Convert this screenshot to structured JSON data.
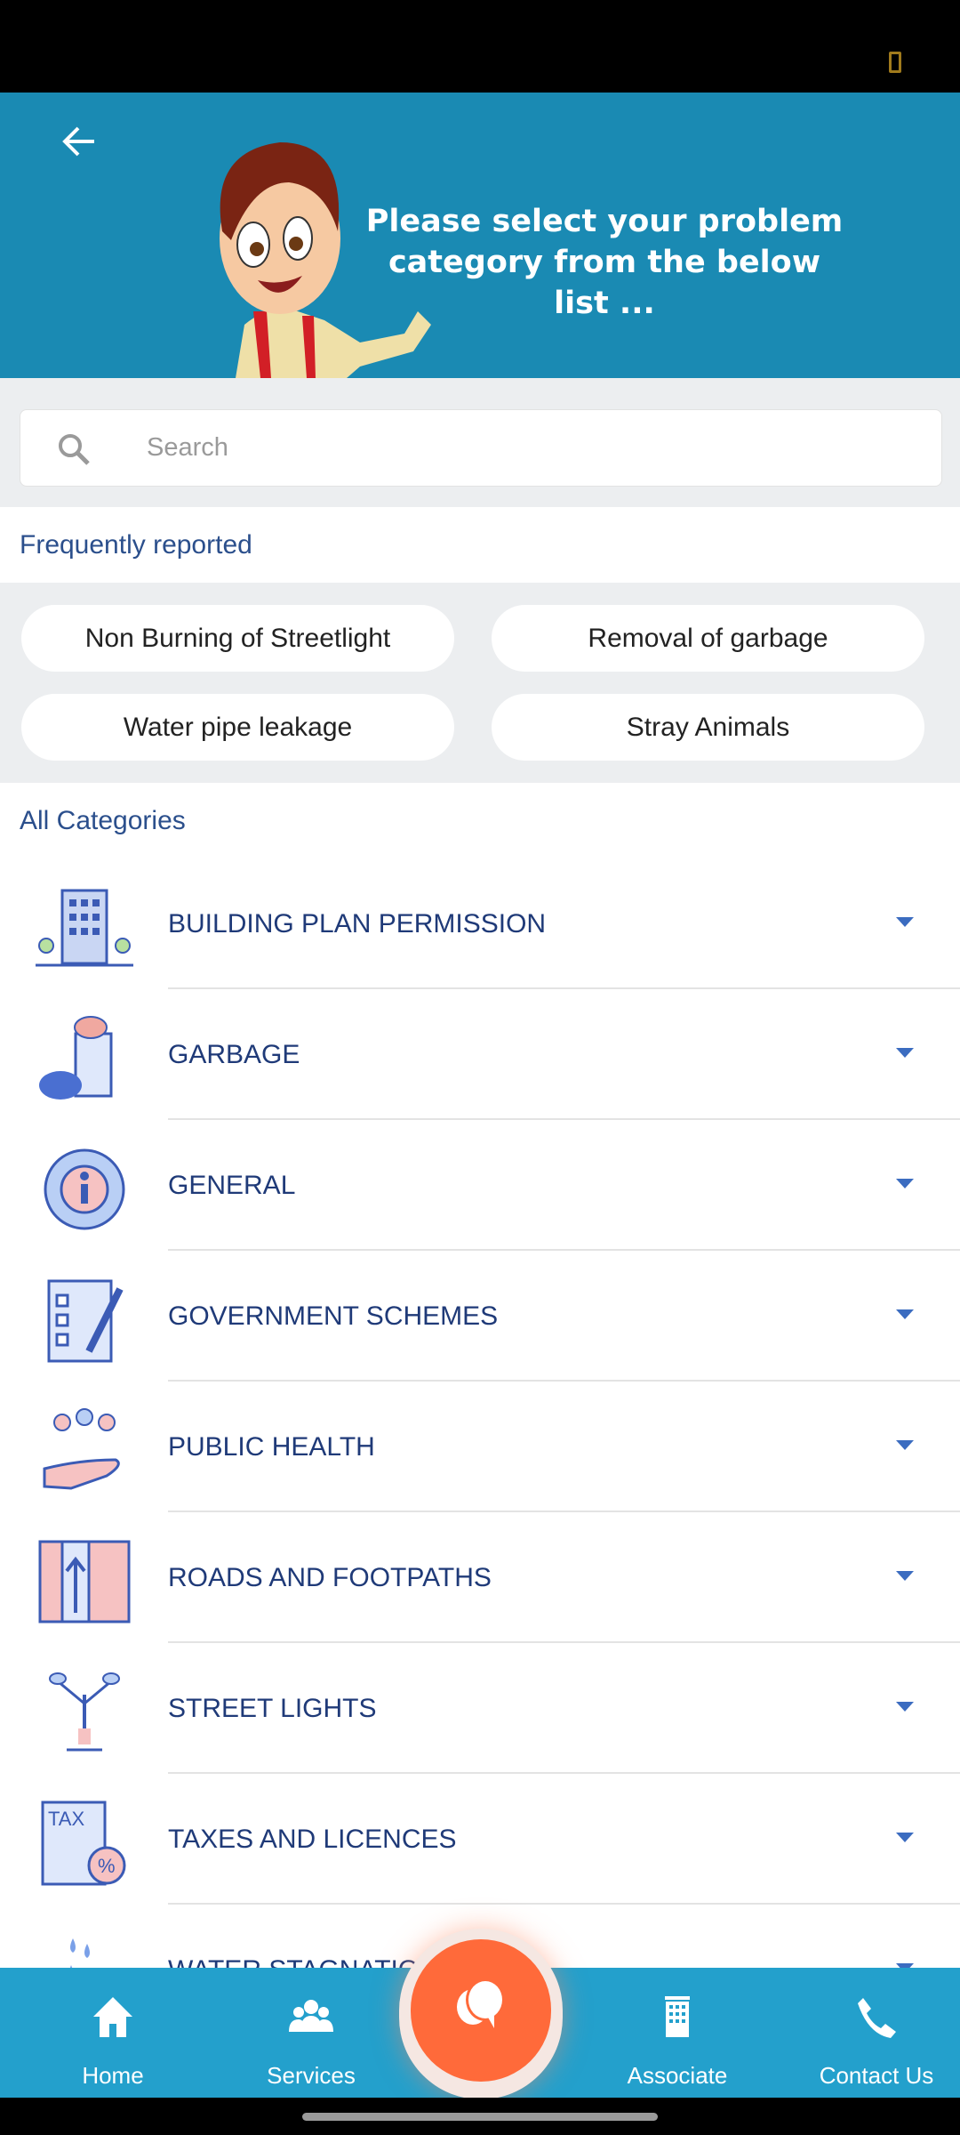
{
  "header": {
    "back_icon": "arrow-left-icon",
    "message": "Please select your problem category from the below list ...",
    "background": "#1a8ab3"
  },
  "search": {
    "placeholder": "Search",
    "value": ""
  },
  "frequent": {
    "title": "Frequently reported",
    "chips": [
      "Non Burning of Streetlight",
      "Removal of garbage",
      "Water pipe leakage",
      "Stray Animals"
    ]
  },
  "categories": {
    "title": "All Categories",
    "items": [
      {
        "label": "BUILDING PLAN PERMISSION",
        "icon": "building-icon"
      },
      {
        "label": "GARBAGE",
        "icon": "garbage-bin-icon"
      },
      {
        "label": "GENERAL",
        "icon": "info-icon"
      },
      {
        "label": "GOVERNMENT SCHEMES",
        "icon": "clipboard-checklist-icon"
      },
      {
        "label": "PUBLIC HEALTH",
        "icon": "people-hand-icon"
      },
      {
        "label": "ROADS AND FOOTPATHS",
        "icon": "road-map-icon"
      },
      {
        "label": "STREET LIGHTS",
        "icon": "street-lamp-icon"
      },
      {
        "label": "TAXES AND LICENCES",
        "icon": "tax-document-icon"
      },
      {
        "label": "WATER STAGNATION",
        "icon": "water-drops-icon"
      }
    ]
  },
  "nav": {
    "items": [
      {
        "label": "Home",
        "icon": "home-icon"
      },
      {
        "label": "Services",
        "icon": "users-icon"
      },
      {
        "label": "Associate",
        "icon": "building-icon"
      },
      {
        "label": "Contact Us",
        "icon": "phone-icon"
      }
    ],
    "fab_icon": "chat-bubbles-icon",
    "accent": "#ff6a3a",
    "bar_color": "#23a0cc"
  }
}
